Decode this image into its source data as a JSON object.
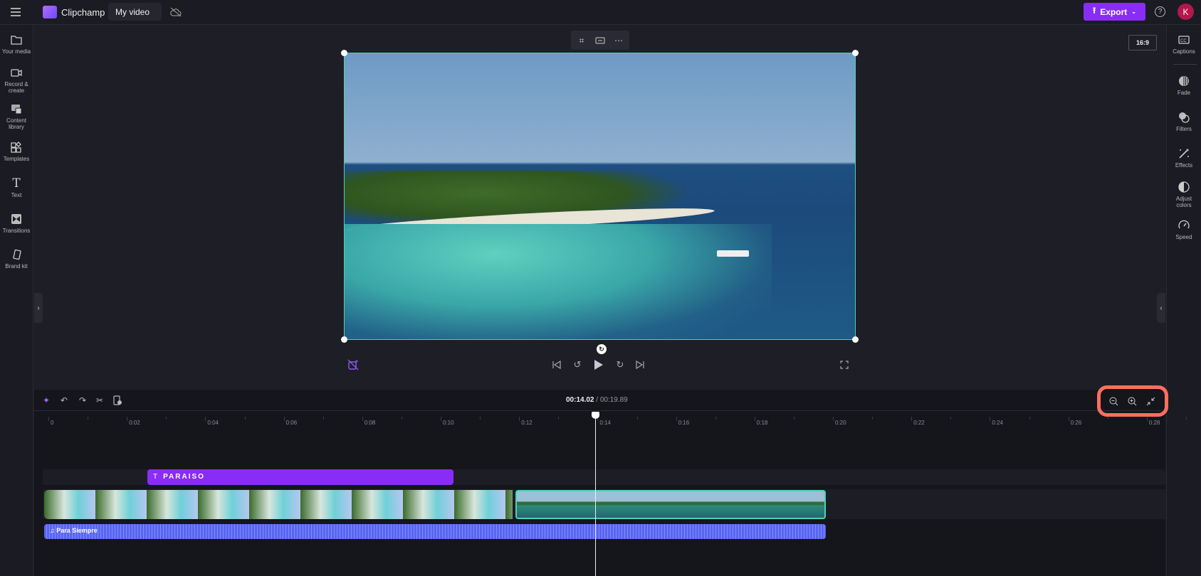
{
  "topbar": {
    "app_name": "Clipchamp",
    "project_title": "My video",
    "export_label": "Export",
    "avatar_initial": "K"
  },
  "left_sidebar": {
    "items": [
      {
        "label": "Your media",
        "icon": "folder-icon"
      },
      {
        "label": "Record & create",
        "icon": "camera-icon"
      },
      {
        "label": "Content library",
        "icon": "library-icon"
      },
      {
        "label": "Templates",
        "icon": "templates-icon"
      },
      {
        "label": "Text",
        "icon": "text-icon"
      },
      {
        "label": "Transitions",
        "icon": "transitions-icon"
      },
      {
        "label": "Brand kit",
        "icon": "brand-kit-icon"
      }
    ]
  },
  "right_sidebar": {
    "items": [
      {
        "label": "Captions",
        "icon": "cc-icon"
      },
      {
        "label": "Fade",
        "icon": "fade-icon"
      },
      {
        "label": "Filters",
        "icon": "filters-icon"
      },
      {
        "label": "Effects",
        "icon": "effects-icon"
      },
      {
        "label": "Adjust colors",
        "icon": "adjust-colors-icon"
      },
      {
        "label": "Speed",
        "icon": "speed-icon"
      }
    ]
  },
  "preview": {
    "aspect_ratio": "16:9"
  },
  "timeline": {
    "current_time": "00:14.02",
    "total_time": "/ 00:19.89",
    "ruler": [
      "0",
      "0:02",
      "0:04",
      "0:06",
      "0:08",
      "0:10",
      "0:12",
      "0:14",
      "0:16",
      "0:18",
      "0:20",
      "0:22",
      "0:24",
      "0:26",
      "0:28"
    ],
    "text_clip": "PARAISO",
    "audio_clip": "Para Siempre"
  },
  "colors": {
    "accent": "#8a2cf7",
    "selection": "#4fd1b4",
    "audio": "#5865f2",
    "highlight": "#ff6f5e",
    "avatar": "#b5174b"
  }
}
